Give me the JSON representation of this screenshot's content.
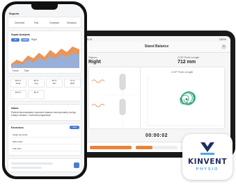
{
  "tablet": {
    "status_left": "9:41",
    "status_right": "100%",
    "title": "Stand Balance",
    "close_label": "×",
    "left_label": "Stance",
    "left_value": "Right",
    "cop_label": "COP Path Length",
    "cop_value": "712 mm",
    "panel_caption": "COP Path Length",
    "timer": "00:00:02",
    "colors": {
      "accent": "#e8833a",
      "trace": "#2aa876"
    }
  },
  "phone": {
    "header": "Reports",
    "tabs": [
      "Overview",
      "Test",
      "Compare",
      "Sessions"
    ],
    "section_title": "Squat Analysis",
    "filters": [
      "All",
      "Left",
      "Right"
    ],
    "legend": [
      "Force",
      "Time"
    ],
    "stats": [
      {
        "label": "Peak",
        "value": "100 %"
      },
      {
        "label": "Avg",
        "value": "85 %"
      },
      {
        "label": "Min",
        "value": "65 %"
      },
      {
        "label": "RFD",
        "value": "72 %"
      }
    ],
    "notes_title": "Notes",
    "notes_text": "Patient demonstrated improved balance and symmetry during today's session. Continue progression.",
    "exercises_title": "Exercises",
    "exercise_rows": [
      "Single leg squat",
      "Split squat",
      "Calf raise"
    ],
    "add_label": "Add",
    "colors": {
      "accent": "#4a7bd3",
      "area": "#e8833a",
      "area2": "#8fb3e6"
    }
  },
  "app_icon": {
    "brand": "KINVENT",
    "sub": "PHYSIO",
    "colors": {
      "primary": "#1f2f63",
      "secondary": "#4fa6e0"
    }
  }
}
